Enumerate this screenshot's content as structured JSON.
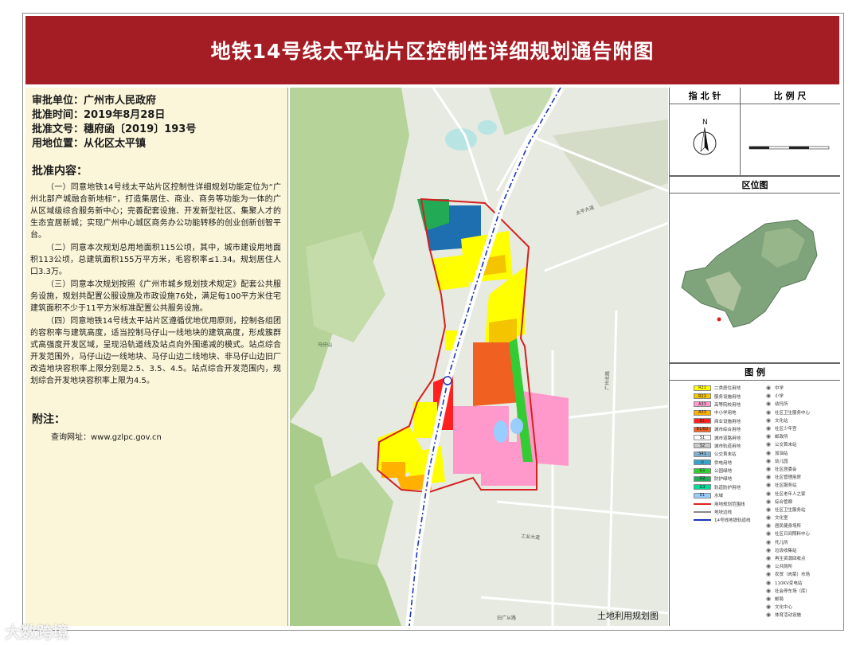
{
  "title": "地铁14号线太平站片区控制性详细规划通告附图",
  "meta": [
    {
      "label": "审批单位：",
      "value": "广州市人民政府"
    },
    {
      "label": "批准时间：",
      "value": "2019年8月28日"
    },
    {
      "label": "批准文号：",
      "value": "穗府函〔2019〕193号"
    },
    {
      "label": "用地位置：",
      "value": "从化区太平镇"
    }
  ],
  "approval_title": "批准内容：",
  "paragraphs": [
    "（一）同意地铁14号线太平站片区控制性详细规划功能定位为“广州北部产城融合新地标”，打造集居住、商业、商务等功能为一体的广从区域级综合服务新中心；完善配套设施、开发新型社区、集聚人才的生态宜居新城；实现广州中心城区商务办公功能转移的创业创新创智平台。",
    "（二）同意本次规划总用地面积115公顷，其中，城市建设用地面积113公顷，总建筑面积155万平方米，毛容积率≤1.34。规划居住人口3.3万。",
    "（三）同意本次规划按照《广州市城乡规划技术规定》配套公共服务设施，规划共配置公服设施及市政设施76处，满足每100平方米住宅建筑面积不少于11平方米标准配置公共服务设施。",
    "（四）同意地铁14号线太平站片区遵循优地优用原则，控制各组团的容积率与建筑高度，适当控制马仔山一线地块的建筑高度，形成簇群式高强度开发区域，呈现沿轨道线及站点向外围递减的模式。站点综合开发范围外，马仔山边一线地块、马仔山边二线地块、非马仔山边旧厂改造地块容积率上限分别是2.5、3.5、4.5。站点综合开发范围内，规划综合开发地块容积率上限为4.5。"
  ],
  "note_title": "附注：",
  "note_url": "查询网址：www.gzlpc.gov.cn",
  "right_panel": {
    "north_label": "指 北 针",
    "scale_label": "比 例 尺",
    "north_letter": "N",
    "location_label": "区位图",
    "legend_label": "图 例"
  },
  "legend_left": [
    {
      "code": "R21",
      "label": "二类居住用地",
      "color": "#ffff00"
    },
    {
      "code": "R22",
      "label": "服务设施用地",
      "color": "#f5c400"
    },
    {
      "code": "A33",
      "label": "高等院校用地",
      "color": "#ff99cc"
    },
    {
      "code": "A33",
      "label": "中小学用地",
      "color": "#ffb000"
    },
    {
      "code": "B1",
      "label": "商业设施用地",
      "color": "#ff2020"
    },
    {
      "code": "B1/B2",
      "label": "城市综合用地",
      "color": "#f06020"
    },
    {
      "code": "S1",
      "label": "城市道路用地",
      "color": "#ffffff"
    },
    {
      "code": "S2",
      "label": "城市轨道用地",
      "color": "#c8c8c8"
    },
    {
      "code": "S41",
      "label": "公交首末站",
      "color": "#7fb0d0"
    },
    {
      "code": "U",
      "label": "供电用地",
      "color": "#3aa3c8"
    },
    {
      "code": "G1",
      "label": "公园绿地",
      "color": "#33cc33"
    },
    {
      "code": "G2",
      "label": "防护绿地",
      "color": "#22aa55"
    },
    {
      "code": "G3",
      "label": "轨道防护用地",
      "color": "#00dd99"
    },
    {
      "code": "E1",
      "label": "水域",
      "color": "#99ccff"
    },
    {
      "code": "",
      "label": "用地规划范围线",
      "color": "#ffffff"
    },
    {
      "code": "",
      "label": "地块边线",
      "color": "#ffffff"
    },
    {
      "code": "",
      "label": "14号线地铁轨道线",
      "color": "#ffffff"
    }
  ],
  "legend_right": [
    "中学",
    "小学",
    "幼托所",
    "社区卫生服务中心",
    "文化站",
    "社区少年宫",
    "邮政所",
    "公交首末站",
    "加油站",
    "幼儿园",
    "社区居委会",
    "社区管理用房",
    "社区服务站",
    "社区老年人之家",
    "综合管廊",
    "社区卫生服务站",
    "文化室",
    "居民健身场所",
    "社区日间照料中心",
    "托儿所",
    "垃圾收集站",
    "再生资源回收点",
    "公共厕所",
    "农贸（肉菜）市场",
    "110KV变电站",
    "社会停车场（库）",
    "邮局",
    "文化中心",
    "体育活动设施"
  ],
  "map_labels": {
    "mountain": "马仔山",
    "caption": "土地利用规划图",
    "road1": "工业大道",
    "road2": "太平大道",
    "road3": "广州北路",
    "road4": "旧广从路"
  },
  "watermark": "大数跨境"
}
